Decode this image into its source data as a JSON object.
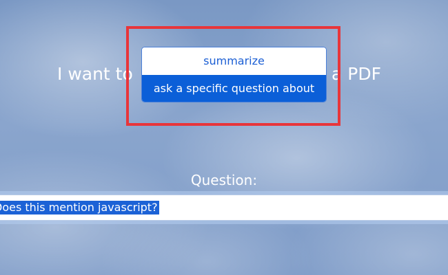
{
  "prompt": {
    "prefix": "I want to",
    "suffix": "a PDF"
  },
  "action_select": {
    "options": [
      {
        "label": "summarize",
        "selected": false
      },
      {
        "label": "ask a specific question about",
        "selected": true
      }
    ]
  },
  "question": {
    "label": "Question:",
    "value": "Does this mention javascript?"
  },
  "colors": {
    "highlight_border": "#e8353a",
    "selected_option_bg": "#0b5fd8",
    "option_text": "#1c5fd4",
    "text_selection_bg": "#1c62d6"
  }
}
